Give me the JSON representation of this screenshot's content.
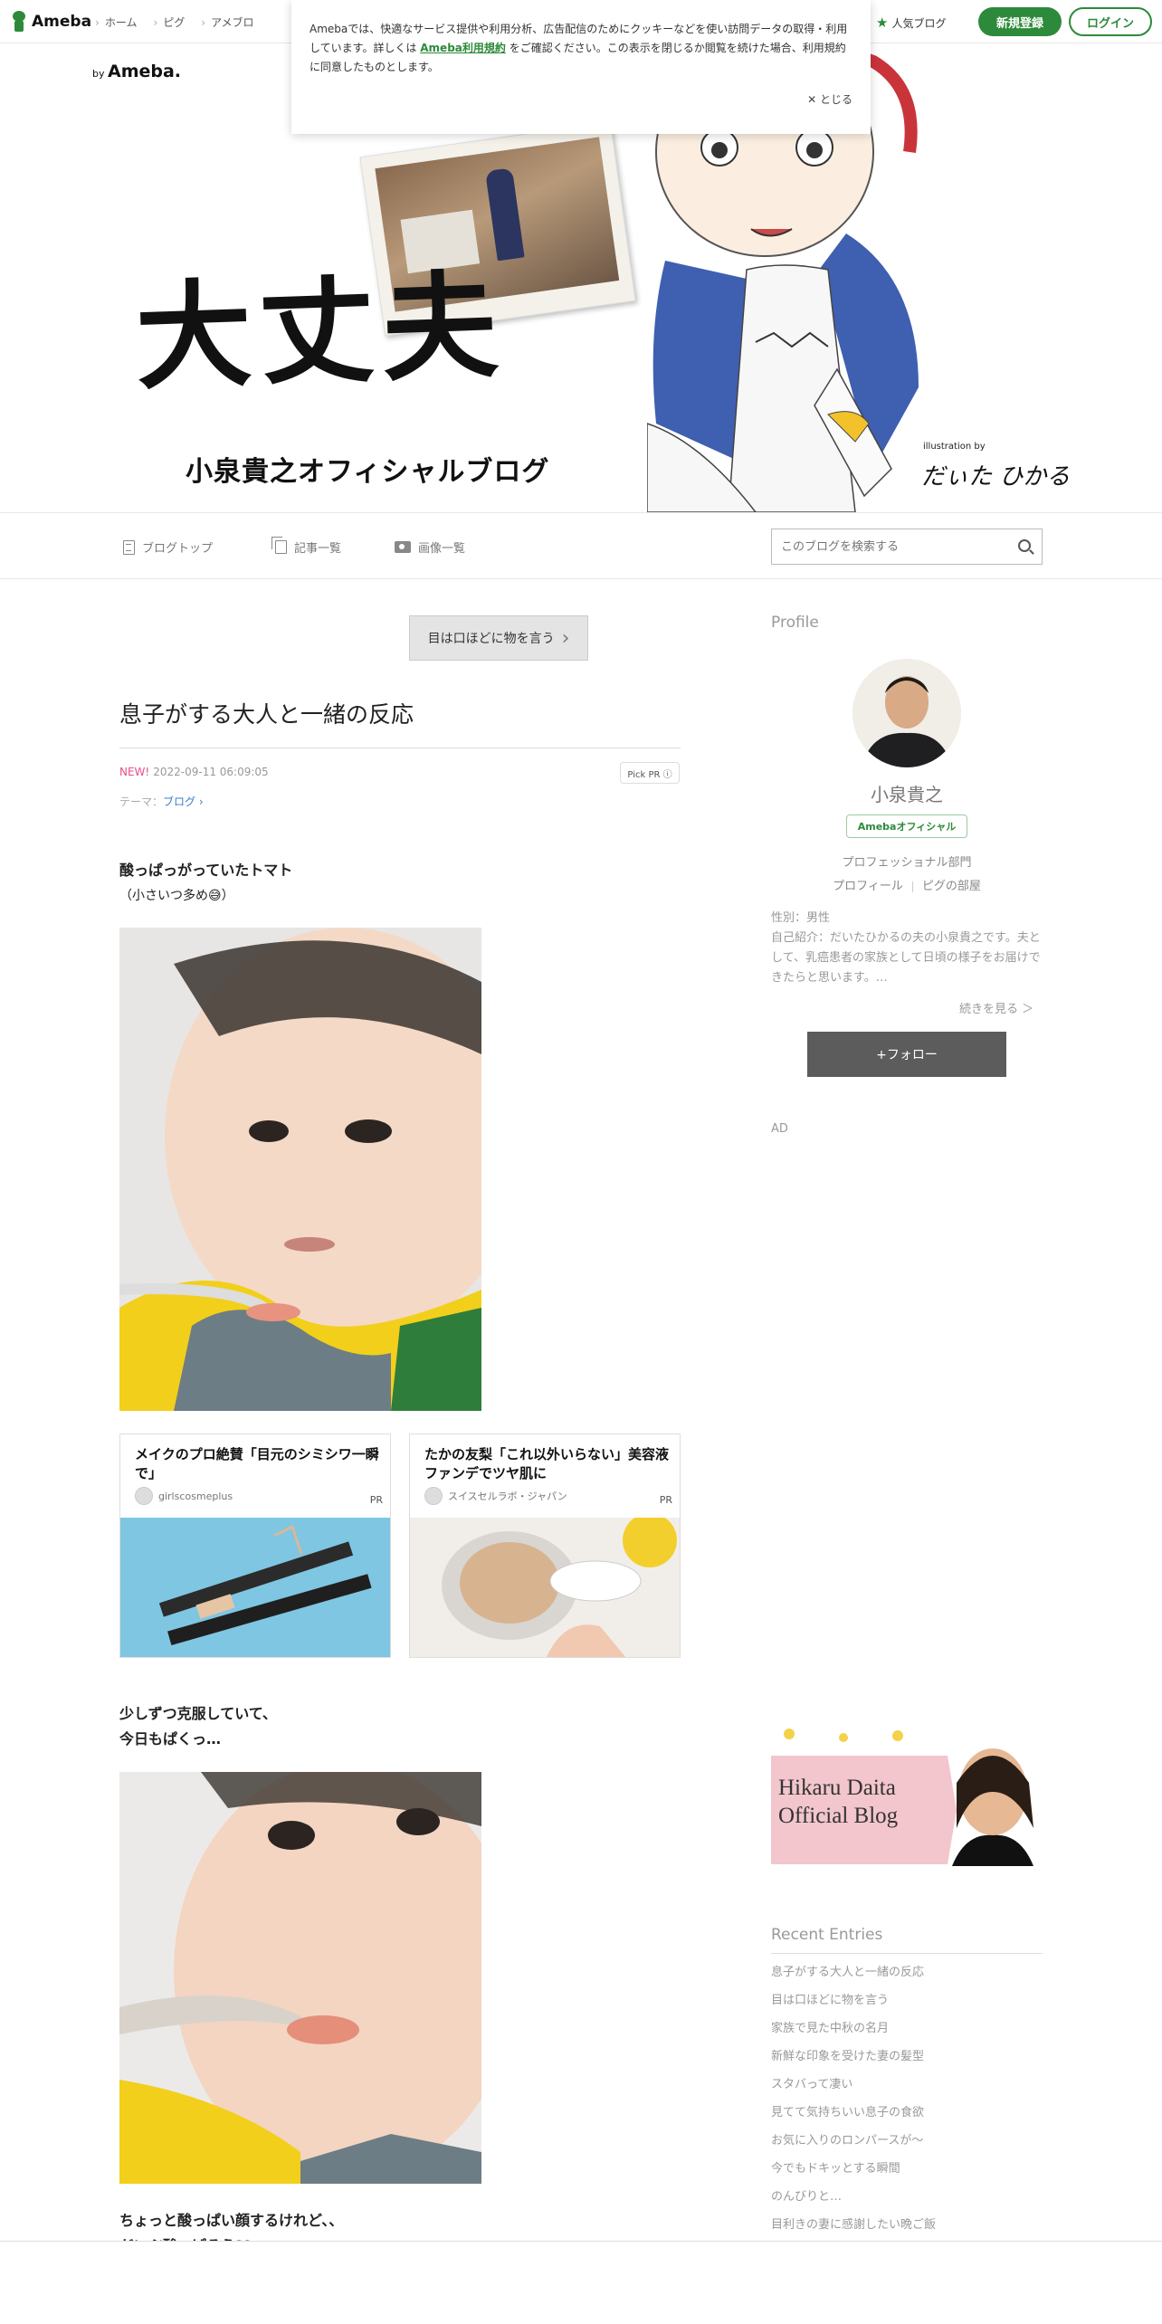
{
  "topbar": {
    "logo_text": "Ameba",
    "nav": [
      "ホーム",
      "ピグ",
      "アメブロ"
    ],
    "popular_blog": "人気ブログ",
    "register": "新規登録",
    "login": "ログイン"
  },
  "cookie": {
    "text_before": "Amebaでは、快適なサービス提供や利用分析、広告配信のためにクッキーなどを使い訪問データの取得・利用しています。詳しくは ",
    "link": "Ameba利用規約",
    "text_after": " をご確認ください。この表示を閉じるか閲覧を続けた場合、利用規約に同意したものとします。",
    "close": "とじる"
  },
  "banner": {
    "by": "by",
    "by_brand": "Ameba.",
    "title": "大丈夫",
    "subtitle": "小泉貴之オフィシャルブログ",
    "illustration_by": "illustration by",
    "signature": "だぃた ひかる"
  },
  "blognav": {
    "top": "ブログトップ",
    "list": "記事一覧",
    "images": "画像一覧",
    "search_placeholder": "このブログを検索する"
  },
  "article": {
    "prev_button": "目は口ほどに物を言う",
    "title": "息子がする大人と一緒の反応",
    "new_label": "NEW!",
    "datetime": "2022-09-11 06:09:05",
    "pick_pr": "Pick PR ⓘ",
    "theme_label": "テーマ：",
    "theme_link": "ブログ ›",
    "para1_line1": "酸っぱっがっていたトマト",
    "para1_line2": "（小さいつ多め😅）",
    "para2_line1": "少しずつ克服していて、",
    "para2_line2": "今日もぱくっ…",
    "para3_line1": "ちょっと酸っぱい顔するけれど、、",
    "para3_line2": "だいぶ酸っぱそう??"
  },
  "ads": [
    {
      "title": "メイクのプロ絶賛「目元のシミシワ一瞬で」",
      "source": "girlscosmeplus",
      "pr": "PR"
    },
    {
      "title": "たかの友梨「これ以外いらない」美容液ファンデでツヤ肌に",
      "source": "スイスセルラボ・ジャパン",
      "pr": "PR"
    }
  ],
  "sidebar": {
    "profile_heading": "Profile",
    "name": "小泉貴之",
    "badge": "Amebaオフィシャル",
    "division": "プロフェッショナル部門",
    "link_profile": "プロフィール",
    "link_pig": "ピグの部屋",
    "gender": "性別：男性",
    "intro": "自己紹介：だいたひかるの夫の小泉貴之です。夫として、乳癌患者の家族として日頃の様子をお届けできたらと思います。…",
    "more": "続きを見る ＞",
    "follow": "+フォロー",
    "ad_label": "AD",
    "banner_line1": "Hikaru Daita",
    "banner_line2": "Official Blog",
    "recent_heading": "Recent Entries",
    "recent": [
      "息子がする大人と一緒の反応",
      "目は口ほどに物を言う",
      "家族で見た中秋の名月",
      "新鮮な印象を受けた妻の髪型",
      "スタバって凄い",
      "見てて気持ちいい息子の食欲",
      "お気に入りのロンパースが〜",
      "今でもドキッとする瞬間",
      "のんびりと…",
      "目利きの妻に感謝したい晩ご飯"
    ]
  },
  "colors": {
    "brand_green": "#2d8a3a",
    "new_pink": "#e94d8b",
    "follow_gray": "#5c5c5c"
  }
}
